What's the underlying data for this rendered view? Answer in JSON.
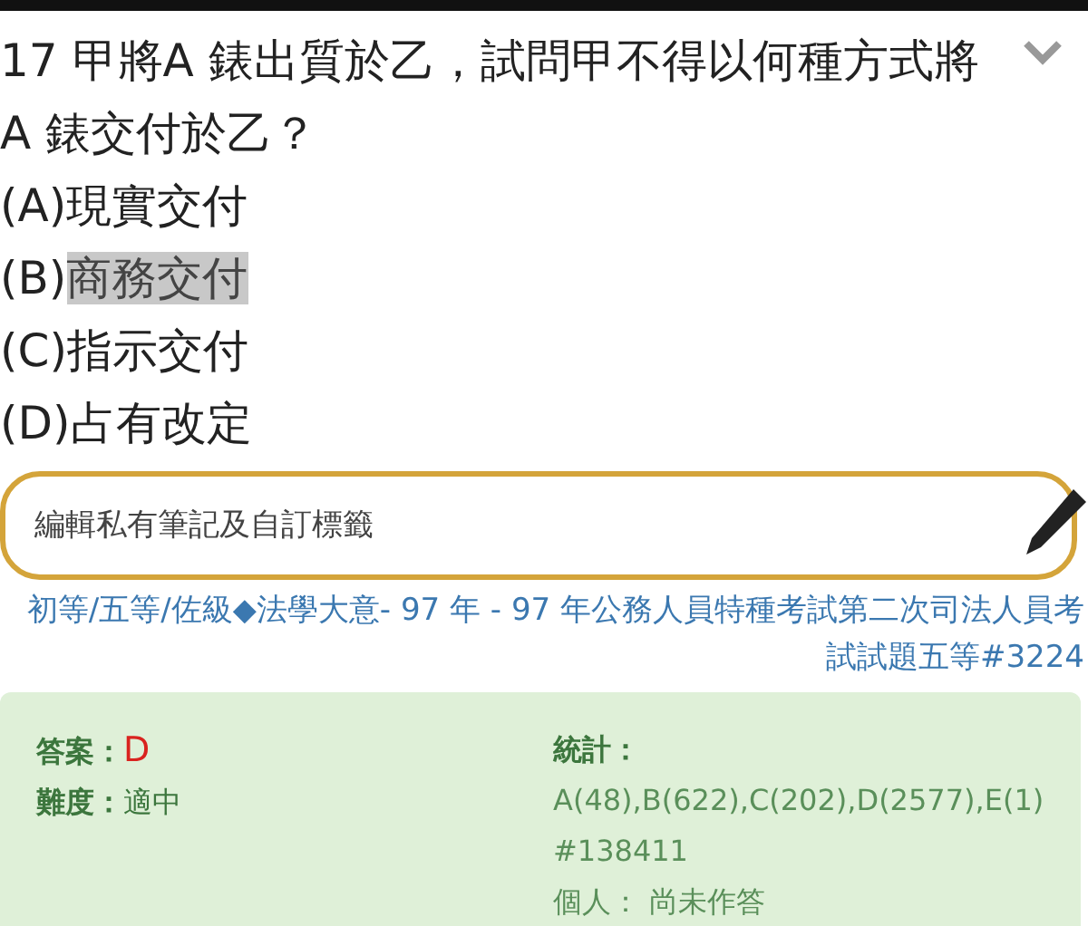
{
  "question": {
    "text": "17 甲將A 錶出質於乙，試問甲不得以何種方式將A 錶交付於乙？"
  },
  "options": [
    {
      "label": "(A)",
      "text": "現實交付",
      "highlighted": false
    },
    {
      "label": "(B)",
      "text": "商務交付",
      "highlighted": true
    },
    {
      "label": "(C)",
      "text": "指示交付",
      "highlighted": false
    },
    {
      "label": "(D)",
      "text": "占有改定",
      "highlighted": false
    }
  ],
  "note_field": {
    "placeholder": "編輯私有筆記及自訂標籤"
  },
  "source": {
    "text": "初等/五等/佐級◆法學大意- 97 年 - 97 年公務人員特種考試第二次司法人員考試試題五等#3224"
  },
  "answer_panel": {
    "answer_label": "答案：",
    "answer": "D",
    "difficulty_label": "難度：",
    "difficulty": "適中",
    "stats_label": "統計：",
    "stats": "A(48),B(622),C(202),D(2577),E(1)",
    "id": "#138411",
    "personal": "個人： 尚未作答"
  }
}
